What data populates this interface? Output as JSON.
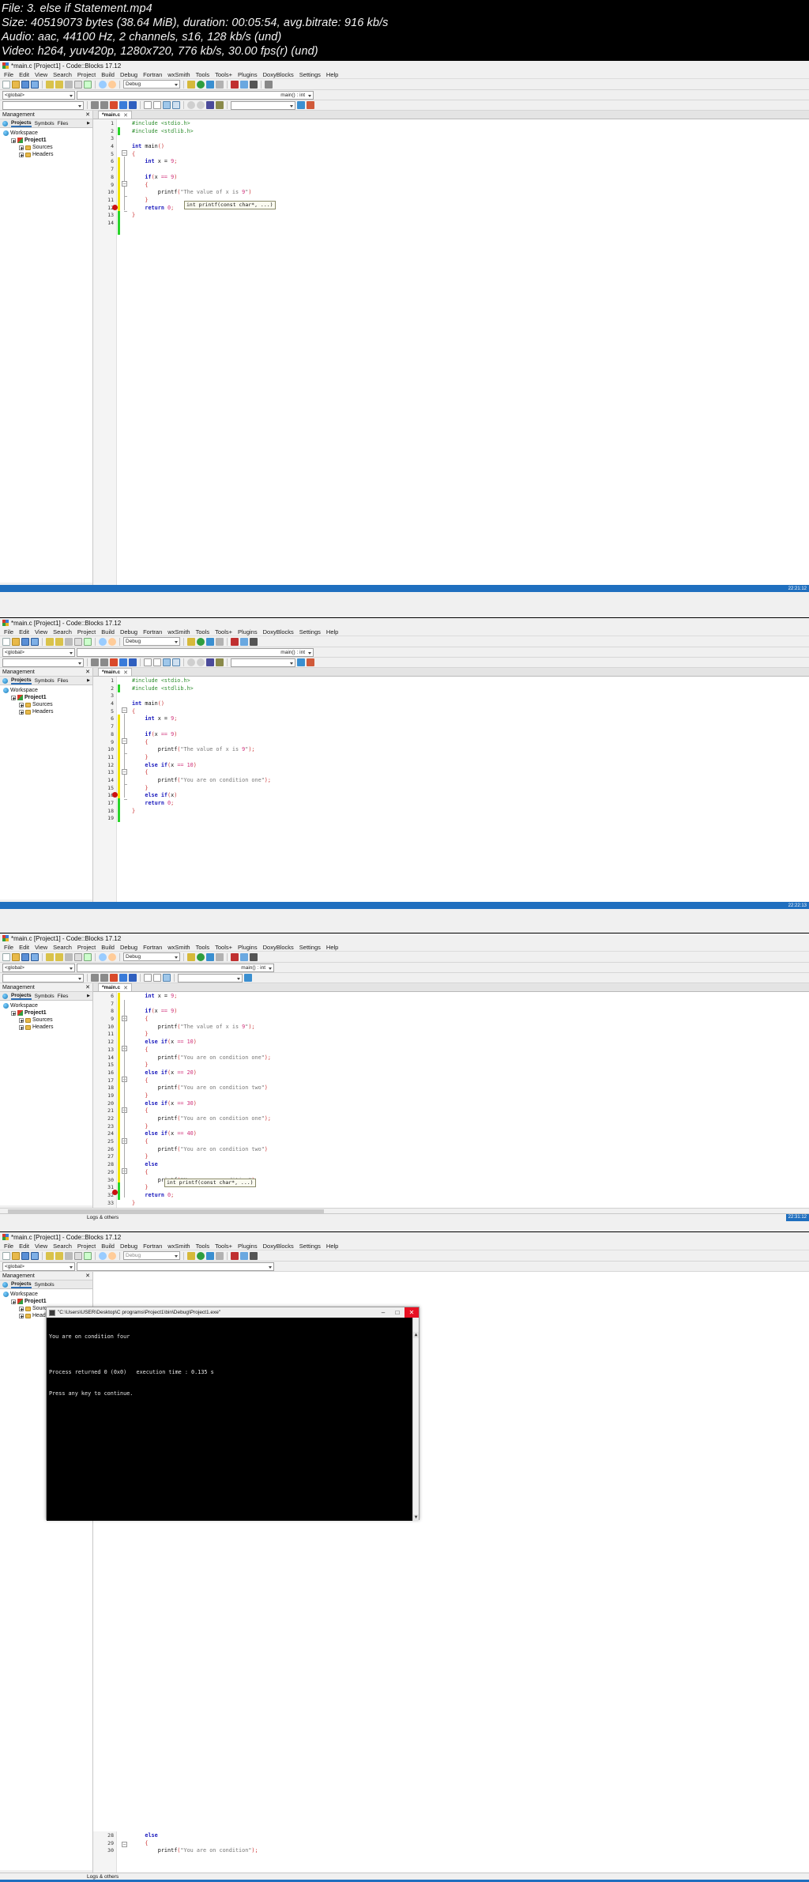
{
  "video_info": {
    "file": "File: 3. else if Statement.mp4",
    "size": "Size: 40519073 bytes (38.64 MiB), duration: 00:05:54, avg.bitrate: 916 kb/s",
    "audio": "Audio: aac, 44100 Hz, 2 channels, s16, 128 kb/s (und)",
    "video": "Video: h264, yuv420p, 1280x720, 776 kb/s, 30.00 fps(r) (und)"
  },
  "app": {
    "title": "*main.c [Project1] - Code::Blocks 17.12",
    "menu": [
      "File",
      "Edit",
      "View",
      "Search",
      "Project",
      "Build",
      "Debug",
      "Fortran",
      "wxSmith",
      "Tools",
      "Tools+",
      "Plugins",
      "DoxyBlocks",
      "Settings",
      "Help"
    ],
    "build_target": "Debug",
    "scope_global": "<global>",
    "scope_symbol": "main() : int",
    "mgmt_title": "Management",
    "mgmt_close": "✕",
    "mgmt_tabs": [
      "Projects",
      "Symbols",
      "Files"
    ],
    "mgmt_tabs_more": "▶",
    "tree": [
      "Workspace",
      "Project1",
      "Sources",
      "Headers"
    ],
    "editor_tab": "*main.c",
    "editor_tab_close": "✕",
    "logs_label": "Logs & others",
    "tooltip_printf": "int printf(const char*, ...)"
  },
  "panels": [
    {
      "id": "panel-1",
      "status_time": "22:21:12",
      "lines": [
        {
          "n": 1,
          "text": "#include <stdio.h>",
          "kind": "pre"
        },
        {
          "n": 2,
          "text": "#include <stdlib.h>",
          "kind": "pre"
        },
        {
          "n": 3,
          "text": "",
          "kind": "plain"
        },
        {
          "n": 4,
          "text": "int main()",
          "kind": "decl"
        },
        {
          "n": 5,
          "text": "{",
          "kind": "brace"
        },
        {
          "n": 6,
          "text": "    int x = 9;",
          "kind": "stmt"
        },
        {
          "n": 7,
          "text": "",
          "kind": "plain"
        },
        {
          "n": 8,
          "text": "    if(x == 9)",
          "kind": "cond"
        },
        {
          "n": 9,
          "text": "    {",
          "kind": "brace"
        },
        {
          "n": 10,
          "text": "        printf(\"The value of x is 9\")",
          "kind": "call"
        },
        {
          "n": 11,
          "text": "    }",
          "kind": "brace"
        },
        {
          "n": 12,
          "text": "    return 0;",
          "kind": "ret"
        },
        {
          "n": 13,
          "text": "}",
          "kind": "brace"
        },
        {
          "n": 14,
          "text": "",
          "kind": "plain"
        }
      ]
    },
    {
      "id": "panel-2",
      "status_time": "22:22:13",
      "lines": [
        {
          "n": 1,
          "text": "#include <stdio.h>",
          "kind": "pre"
        },
        {
          "n": 2,
          "text": "#include <stdlib.h>",
          "kind": "pre"
        },
        {
          "n": 3,
          "text": "",
          "kind": "plain"
        },
        {
          "n": 4,
          "text": "int main()",
          "kind": "decl"
        },
        {
          "n": 5,
          "text": "{",
          "kind": "brace"
        },
        {
          "n": 6,
          "text": "    int x = 9;",
          "kind": "stmt"
        },
        {
          "n": 7,
          "text": "",
          "kind": "plain"
        },
        {
          "n": 8,
          "text": "    if(x == 9)",
          "kind": "cond"
        },
        {
          "n": 9,
          "text": "    {",
          "kind": "brace"
        },
        {
          "n": 10,
          "text": "        printf(\"The value of x is 9\");",
          "kind": "call"
        },
        {
          "n": 11,
          "text": "    }",
          "kind": "brace"
        },
        {
          "n": 12,
          "text": "    else if(x == 10)",
          "kind": "cond"
        },
        {
          "n": 13,
          "text": "    {",
          "kind": "brace"
        },
        {
          "n": 14,
          "text": "        printf(\"You are on condition one\");",
          "kind": "call"
        },
        {
          "n": 15,
          "text": "    }",
          "kind": "brace"
        },
        {
          "n": 16,
          "text": "    else if(x)",
          "kind": "cond-sel"
        },
        {
          "n": 17,
          "text": "    return 0;",
          "kind": "ret"
        },
        {
          "n": 18,
          "text": "}",
          "kind": "brace"
        },
        {
          "n": 19,
          "text": "",
          "kind": "plain"
        }
      ]
    },
    {
      "id": "panel-3",
      "status_time": "22:31:12",
      "lines": [
        {
          "n": 6,
          "text": "    int x = 9;",
          "kind": "stmt"
        },
        {
          "n": 7,
          "text": "",
          "kind": "plain"
        },
        {
          "n": 8,
          "text": "    if(x == 9)",
          "kind": "cond"
        },
        {
          "n": 9,
          "text": "    {",
          "kind": "brace"
        },
        {
          "n": 10,
          "text": "        printf(\"The value of x is 9\");",
          "kind": "call"
        },
        {
          "n": 11,
          "text": "    }",
          "kind": "brace"
        },
        {
          "n": 12,
          "text": "    else if(x == 10)",
          "kind": "cond"
        },
        {
          "n": 13,
          "text": "    {",
          "kind": "brace"
        },
        {
          "n": 14,
          "text": "        printf(\"You are on condition one\");",
          "kind": "call"
        },
        {
          "n": 15,
          "text": "    }",
          "kind": "brace"
        },
        {
          "n": 16,
          "text": "    else if(x == 20)",
          "kind": "cond"
        },
        {
          "n": 17,
          "text": "    {",
          "kind": "brace"
        },
        {
          "n": 18,
          "text": "        printf(\"You are on condition two\")",
          "kind": "call"
        },
        {
          "n": 19,
          "text": "    }",
          "kind": "brace"
        },
        {
          "n": 20,
          "text": "    else if(x == 30)",
          "kind": "cond"
        },
        {
          "n": 21,
          "text": "    {",
          "kind": "brace"
        },
        {
          "n": 22,
          "text": "        printf(\"You are on condition one\");",
          "kind": "call"
        },
        {
          "n": 23,
          "text": "    }",
          "kind": "brace"
        },
        {
          "n": 24,
          "text": "    else if(x == 40)",
          "kind": "cond"
        },
        {
          "n": 25,
          "text": "    {",
          "kind": "brace"
        },
        {
          "n": 26,
          "text": "        printf(\"You are on condition two\")",
          "kind": "call"
        },
        {
          "n": 27,
          "text": "    }",
          "kind": "brace"
        },
        {
          "n": 28,
          "text": "    else",
          "kind": "cond"
        },
        {
          "n": 29,
          "text": "    {",
          "kind": "brace"
        },
        {
          "n": 30,
          "text": "        printf(\"You are on condition\")",
          "kind": "call"
        },
        {
          "n": 31,
          "text": "    }",
          "kind": "brace"
        },
        {
          "n": 32,
          "text": "    return 0;",
          "kind": "ret"
        },
        {
          "n": 33,
          "text": "}",
          "kind": "brace"
        },
        {
          "n": 34,
          "text": "",
          "kind": "plain"
        }
      ]
    },
    {
      "id": "panel-4",
      "status_time": "",
      "lines": [
        {
          "n": 28,
          "text": "    else",
          "kind": "cond"
        },
        {
          "n": 29,
          "text": "    {",
          "kind": "brace"
        },
        {
          "n": 30,
          "text": "        printf(\"You are on condition\");",
          "kind": "call"
        }
      ]
    }
  ],
  "console": {
    "title": "\"C:\\Users\\USER\\Desktop\\C programs\\Project1\\bin\\Debug\\Project1.exe\"",
    "minimize": "–",
    "maximize": "□",
    "close": "✕",
    "lines": [
      "You are on condition four",
      "",
      "Process returned 0 (0x0)   execution time : 0.135 s",
      "Press any key to continue."
    ],
    "scroll_up": "▲",
    "scroll_down": "▼"
  }
}
